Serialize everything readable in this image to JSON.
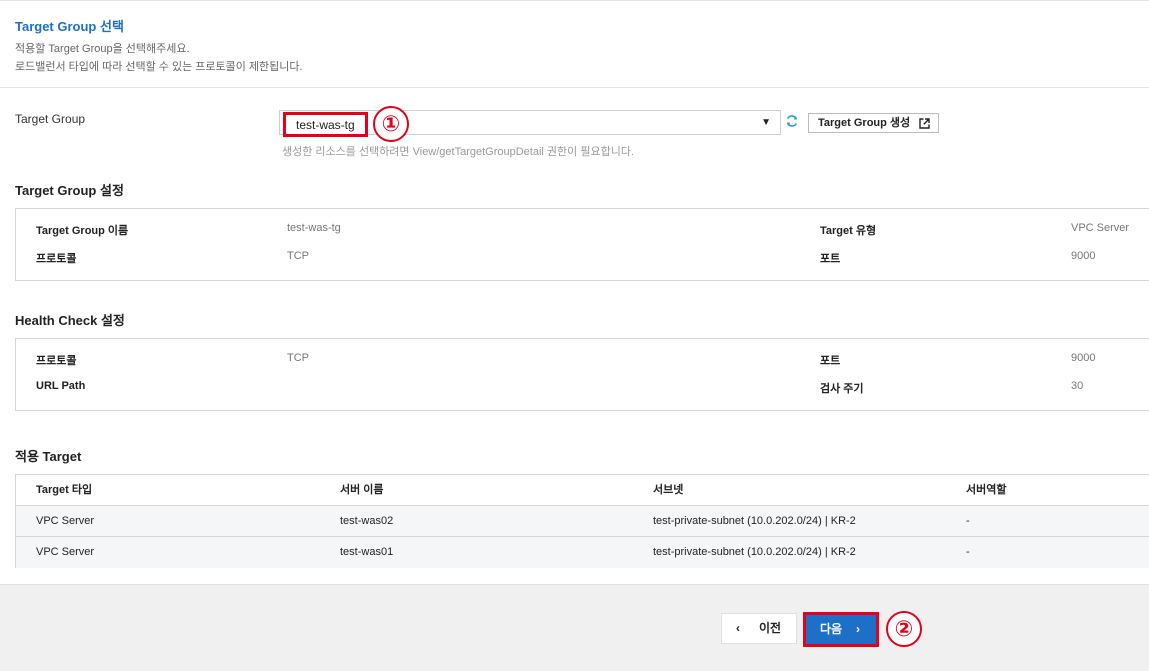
{
  "header": {
    "title": "Target Group 선택",
    "desc1": "적용할 Target Group을 선택해주세요.",
    "desc2": "로드밸런서 타입에 따라 선택할 수 있는 프로토콜이 제한됩니다."
  },
  "target_group": {
    "label": "Target Group",
    "selected": "test-was-tg",
    "create_button": "Target Group 생성",
    "hint": "생성한 리소스를 선택하려면 View/getTargetGroupDetail 권한이 필요합니다."
  },
  "annotations": {
    "one": "①",
    "two": "②"
  },
  "tg_settings": {
    "title": "Target Group 설정",
    "name_label": "Target Group 이름",
    "name_value": "test-was-tg",
    "type_label": "Target 유형",
    "type_value": "VPC Server",
    "protocol_label": "프로토콜",
    "protocol_value": "TCP",
    "port_label": "포트",
    "port_value": "9000"
  },
  "health_check": {
    "title": "Health Check 설정",
    "protocol_label": "프로토콜",
    "protocol_value": "TCP",
    "port_label": "포트",
    "port_value": "9000",
    "path_label": "URL Path",
    "path_value": "",
    "interval_label": "검사 주기",
    "interval_value": "30"
  },
  "targets": {
    "title": "적용 Target",
    "headers": [
      "Target 타입",
      "서버 이름",
      "서브넷",
      "서버역할"
    ],
    "rows": [
      [
        "VPC Server",
        "test-was02",
        "test-private-subnet (10.0.202.0/24) | KR-2",
        "-"
      ],
      [
        "VPC Server",
        "test-was01",
        "test-private-subnet (10.0.202.0/24) | KR-2",
        "-"
      ]
    ]
  },
  "footer": {
    "prev_label": "이전",
    "next_label": "다음"
  },
  "colors": {
    "accent": "#1e6fc8",
    "highlight": "#e6001a",
    "refresh": "#1ea0d4"
  },
  "icons": [
    "refresh-icon",
    "external-link-icon",
    "chevron-down-icon",
    "chevron-left-icon",
    "chevron-right-icon"
  ]
}
